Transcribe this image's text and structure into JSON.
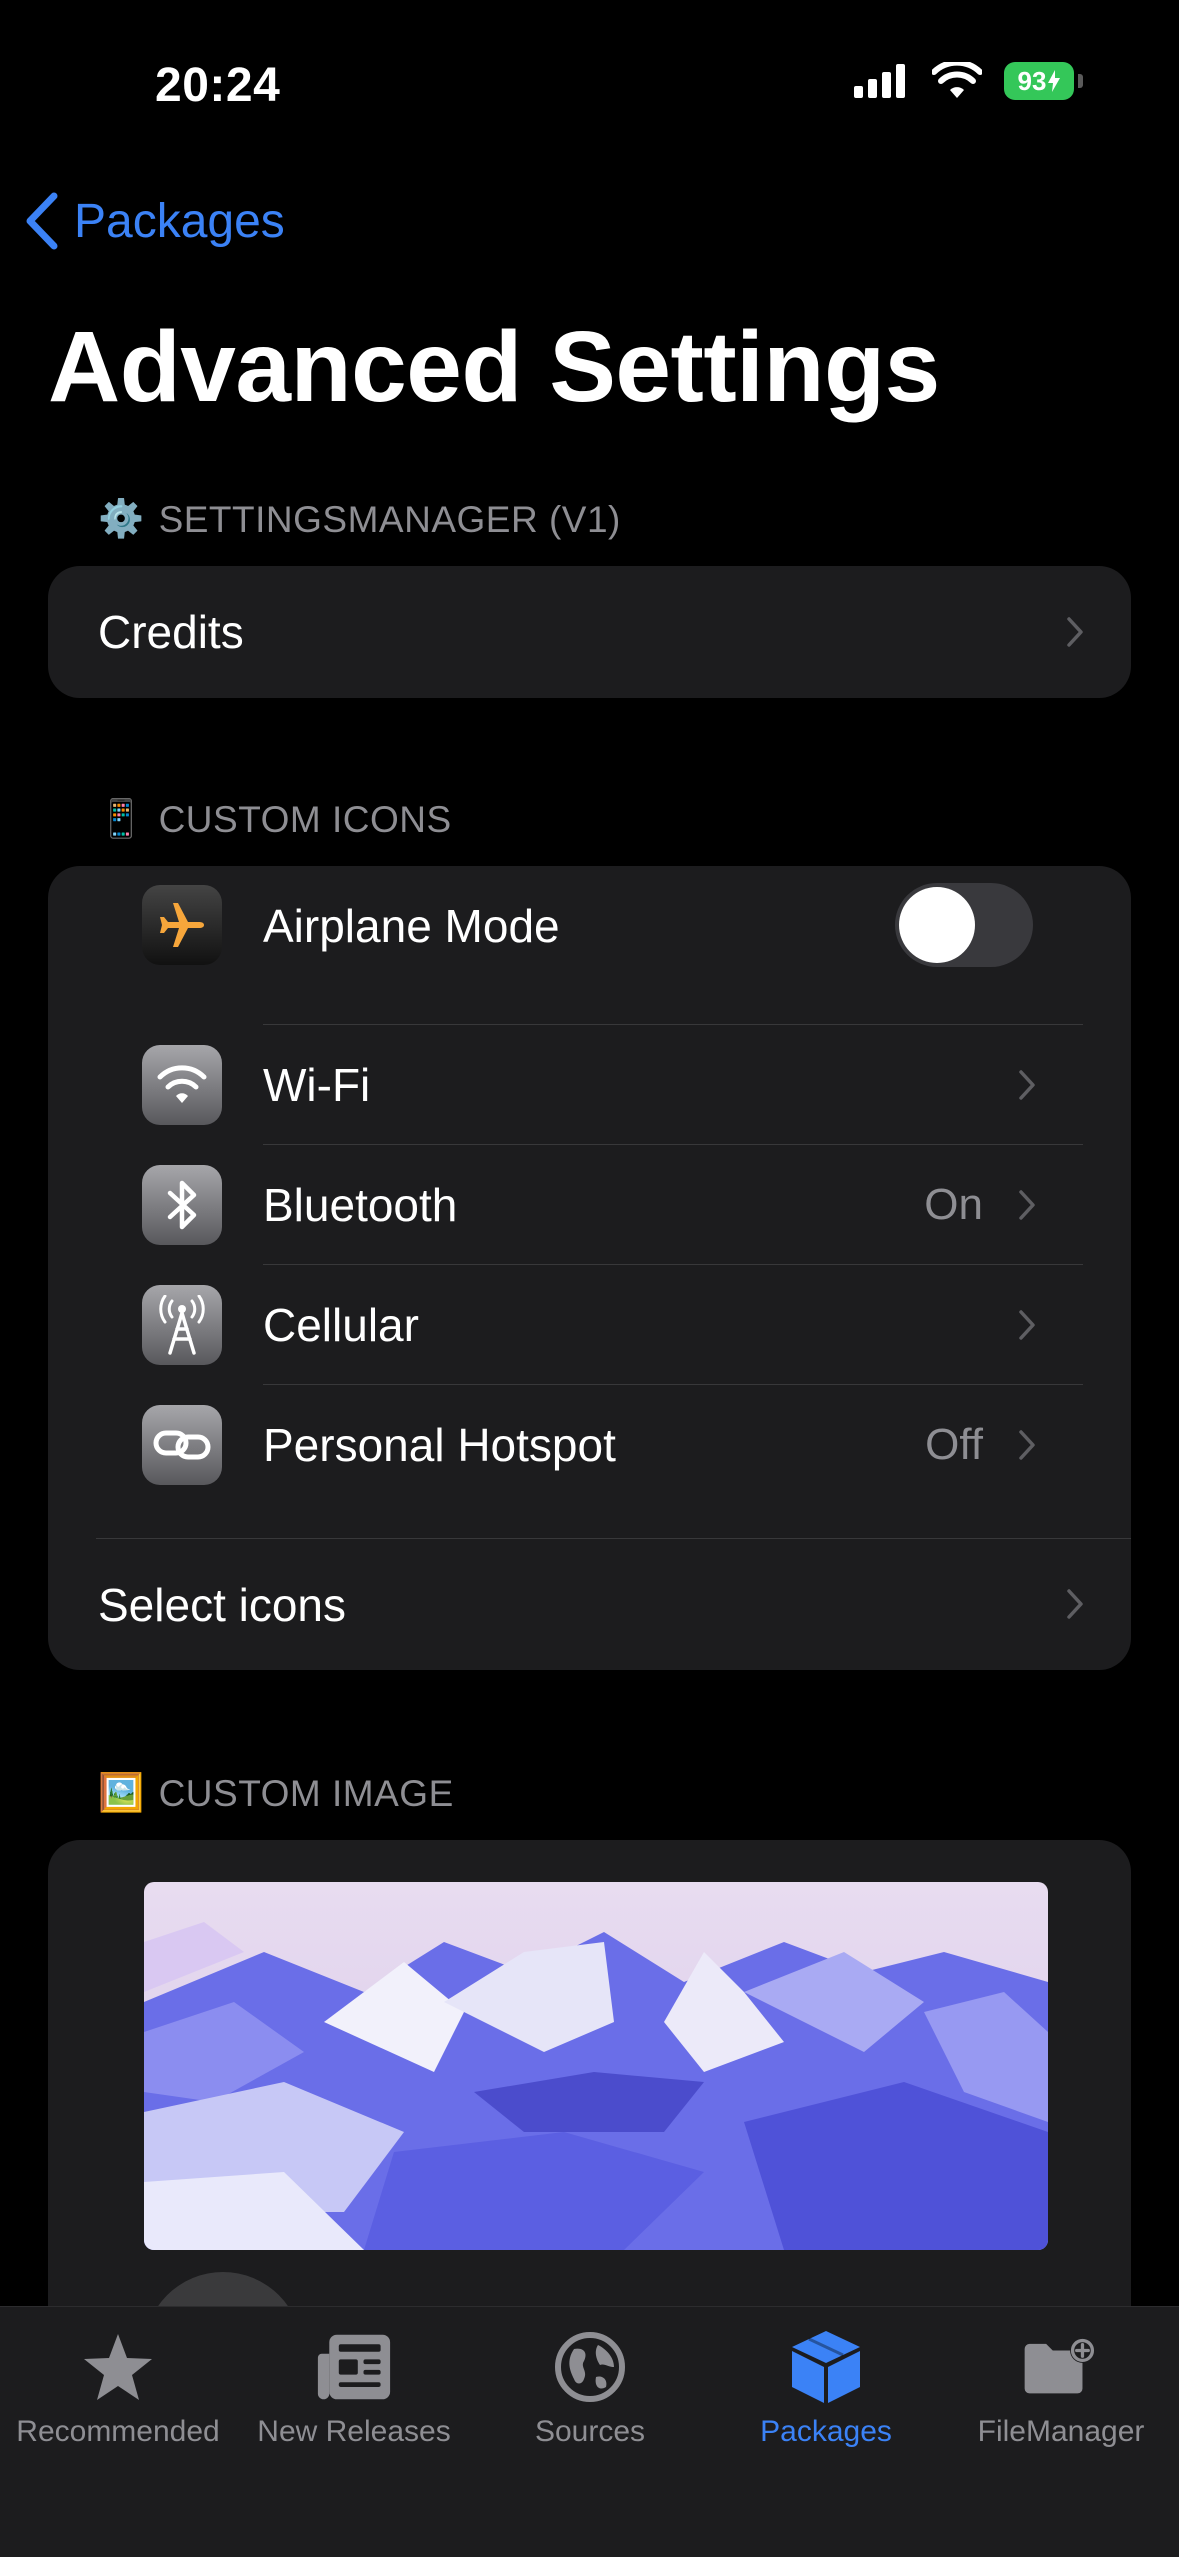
{
  "status_bar": {
    "time": "20:24",
    "battery": "93"
  },
  "nav": {
    "back_label": "Packages"
  },
  "page": {
    "title": "Advanced Settings"
  },
  "sections": {
    "settings_manager": {
      "emoji": "⚙️",
      "header": "SETTINGSMANAGER (V1)",
      "rows": [
        {
          "label": "Credits"
        }
      ]
    },
    "custom_icons": {
      "emoji": "📱",
      "header": "CUSTOM ICONS",
      "rows": [
        {
          "label": "Airplane Mode",
          "icon": "airplane-icon",
          "toggle": false
        },
        {
          "label": "Wi-Fi",
          "icon": "wifi-icon",
          "value": ""
        },
        {
          "label": "Bluetooth",
          "icon": "bluetooth-icon",
          "value": "On"
        },
        {
          "label": "Cellular",
          "icon": "cellular-antenna-icon",
          "value": ""
        },
        {
          "label": "Personal Hotspot",
          "icon": "hotspot-link-icon",
          "value": "Off"
        }
      ],
      "select_label": "Select icons"
    },
    "custom_image": {
      "emoji": "🖼️",
      "header": "CUSTOM IMAGE",
      "image": "low-poly mountain landscape"
    }
  },
  "tab_bar": {
    "tabs": [
      {
        "label": "Recommended",
        "icon": "star-icon",
        "active": false
      },
      {
        "label": "New Releases",
        "icon": "newspaper-icon",
        "active": false
      },
      {
        "label": "Sources",
        "icon": "globe-icon",
        "active": false
      },
      {
        "label": "Packages",
        "icon": "package-box-icon",
        "active": true
      },
      {
        "label": "FileManager",
        "icon": "folder-add-icon",
        "active": false
      }
    ]
  },
  "colors": {
    "accent": "#3b82f6",
    "group_bg": "#1c1c1e",
    "secondary_text": "#8e8e93",
    "battery": "#34c759"
  }
}
